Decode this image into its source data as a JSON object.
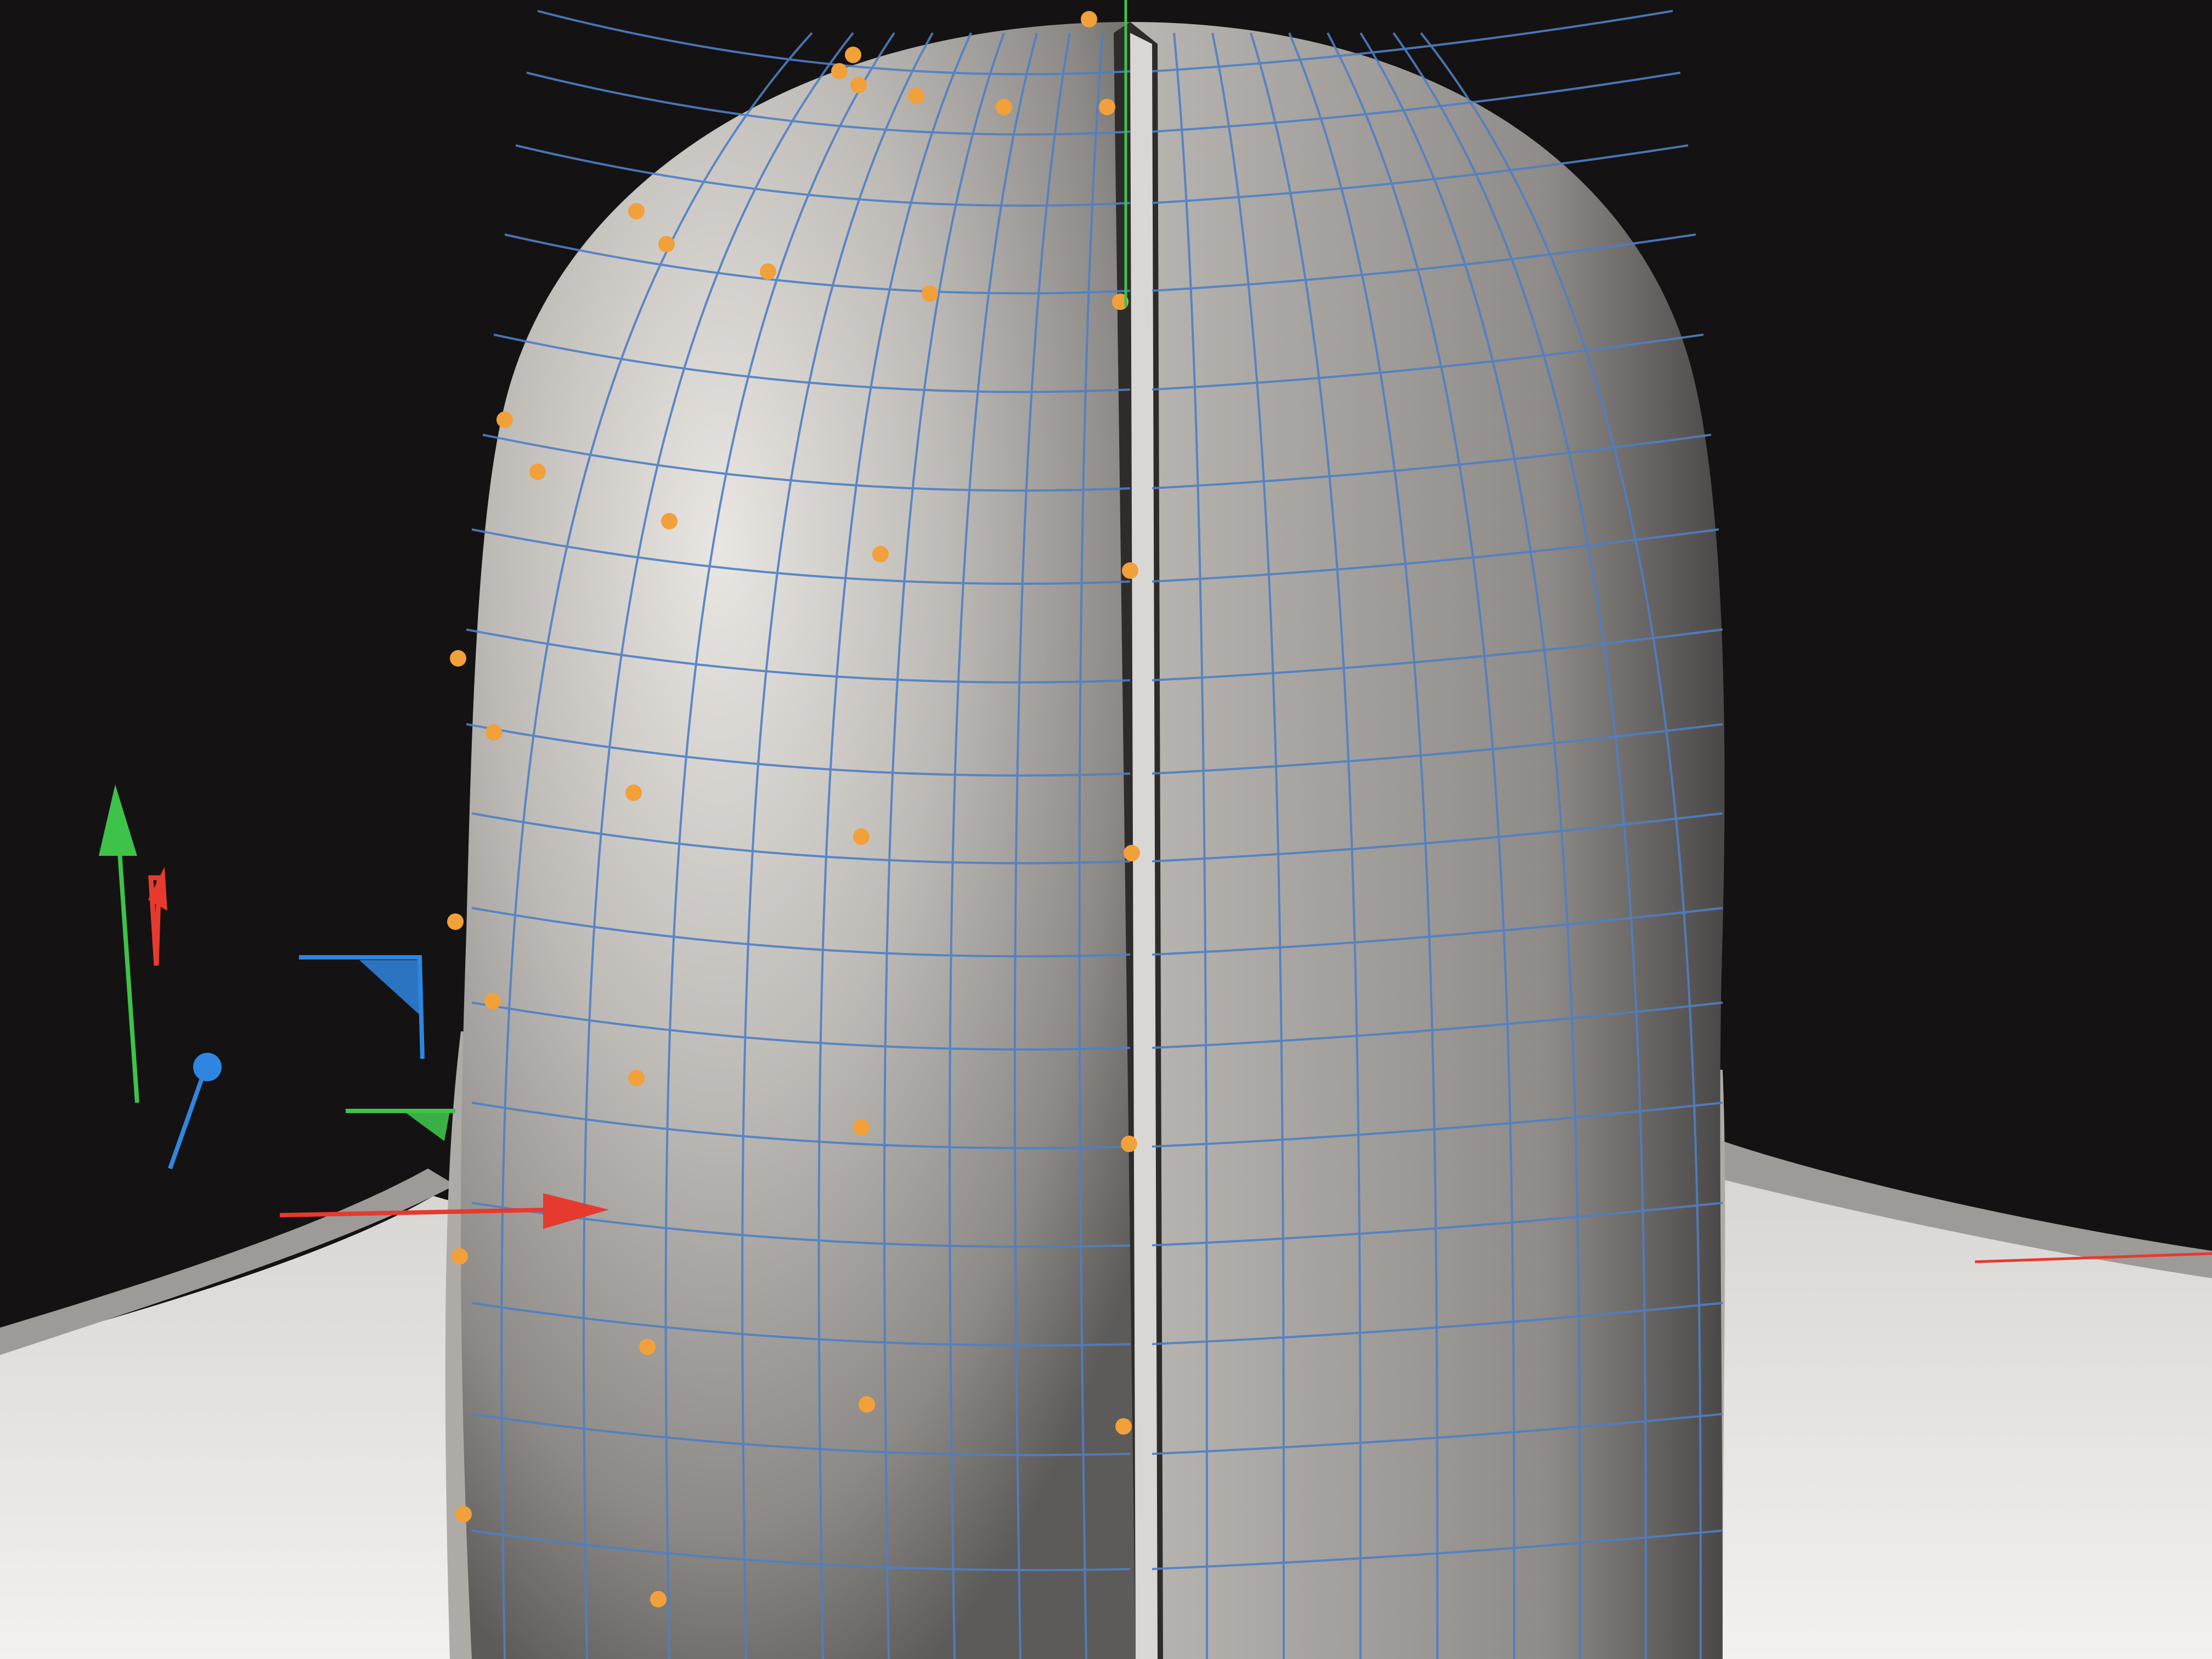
{
  "viewport": {
    "view": "perspective",
    "background_color": "#141213"
  },
  "mesh": {
    "object": "head-and-shoulders-mesh",
    "surface_color": "#bdbab6",
    "wire_color": "#4f7fc4",
    "selected_vertex_color": "#f2a03a"
  },
  "gizmo": {
    "x_axis_color": "#e63a2e",
    "y_axis_color": "#3ec24a",
    "z_axis_color": "#2f86e0"
  },
  "grid": {
    "line_color": "#2a2a2a"
  },
  "icons": [
    "move-gizmo-icon",
    "view-axis-indicator-icon"
  ]
}
